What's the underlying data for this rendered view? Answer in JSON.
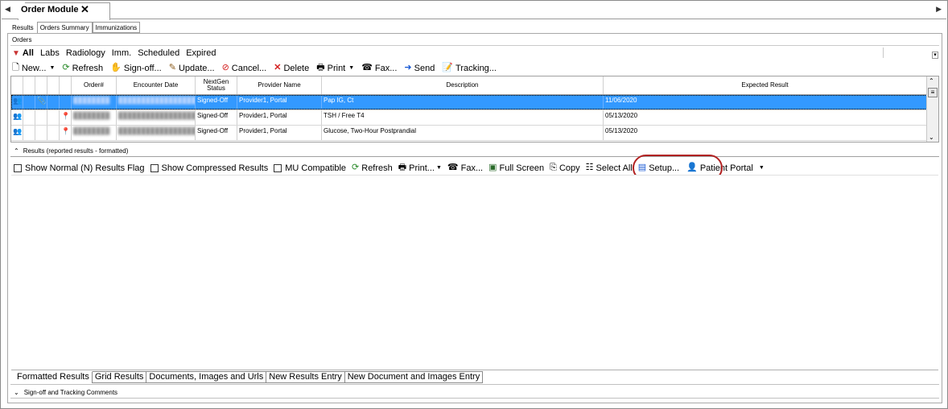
{
  "module_tab": {
    "title": "Order Module",
    "close": "✕"
  },
  "nav": {
    "scroll_left": "◀",
    "scroll_right": "▶"
  },
  "subtabs": [
    "Results",
    "Orders Summary",
    "Immunizations"
  ],
  "orders": {
    "section_label": "Orders",
    "filters": [
      "All",
      "Labs",
      "Radiology",
      "Imm.",
      "Scheduled",
      "Expired"
    ],
    "toolbar": {
      "new": "New...",
      "refresh": "Refresh",
      "signoff": "Sign-off...",
      "update": "Update...",
      "cancel": "Cancel...",
      "delete": "Delete",
      "print": "Print",
      "fax": "Fax...",
      "send": "Send",
      "tracking": "Tracking..."
    },
    "columns": [
      "Order#",
      "Encounter Date",
      "NextGen Status",
      "Provider Name",
      "Description",
      "Expected Result"
    ],
    "rows": [
      {
        "order": "████████",
        "encounter": "██████████████████",
        "status": "Signed-Off",
        "provider": "Provider1, Portal",
        "description": "Pap IG, Ct",
        "expected": "11/06/2020",
        "selected": true
      },
      {
        "order": "████████",
        "encounter": "██████████████████",
        "status": "Signed-Off",
        "provider": "Provider1, Portal",
        "description": "TSH / Free T4",
        "expected": "05/13/2020",
        "selected": false
      },
      {
        "order": "████████",
        "encounter": "██████████████████",
        "status": "Signed-Off",
        "provider": "Provider1, Portal",
        "description": "Glucose, Two-Hour Postprandial",
        "expected": "05/13/2020",
        "selected": false
      }
    ]
  },
  "results": {
    "header": "Results (reported results - formatted)",
    "toolbar": {
      "show_normal": "Show Normal (N) Results Flag",
      "show_compressed": "Show Compressed Results",
      "mu_compatible": "MU Compatible",
      "refresh": "Refresh",
      "print": "Print...",
      "fax": "Fax...",
      "full_screen": "Full Screen",
      "copy": "Copy",
      "select_all": "Select All",
      "setup": "Setup...",
      "patient_portal": "Patient Portal"
    },
    "bottom_tabs": [
      "Formatted Results",
      "Grid Results",
      "Documents, Images and Urls",
      "New Results Entry",
      "New Document and Images Entry"
    ],
    "signoff_label": "Sign-off and Tracking Comments"
  },
  "colors": {
    "selection": "#3399ff",
    "highlight": "#b22222"
  }
}
